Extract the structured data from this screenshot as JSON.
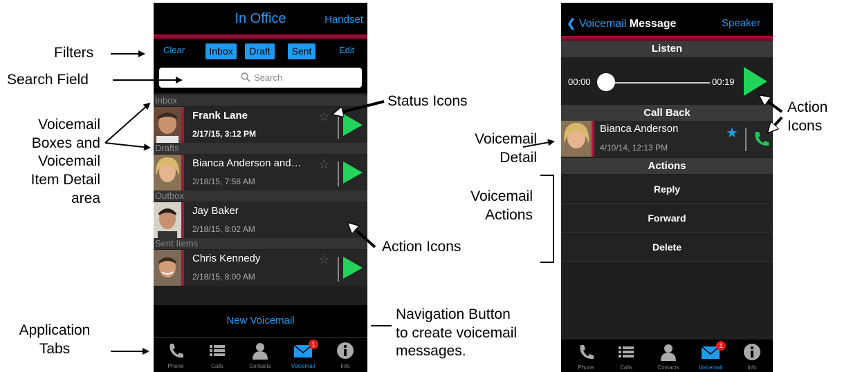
{
  "annotations": {
    "filters": "Filters",
    "search_field": "Search Field",
    "voicemail_boxes": [
      "Voicemail",
      "Boxes and",
      "Voicemail",
      "Item Detail",
      "area"
    ],
    "application_tabs": [
      "Application",
      "Tabs"
    ],
    "status_icons": "Status Icons",
    "action_icons_left": "Action Icons",
    "navigation_button": [
      "Navigation Button",
      "to create voicemail",
      "messages."
    ],
    "action_icons_right": [
      "Action",
      "Icons"
    ],
    "voicemail_detail": [
      "Voicemail",
      "Detail"
    ],
    "voicemail_actions": [
      "Voicemail",
      "Actions"
    ]
  },
  "left_phone": {
    "title": "In Office",
    "handset": "Handset",
    "filters": {
      "clear": "Clear",
      "inbox": "Inbox",
      "draft": "Draft",
      "sent": "Sent",
      "edit": "Edit"
    },
    "search_placeholder": "Search",
    "sections": [
      {
        "label": "Inbox",
        "name": "Frank Lane",
        "date": "2/17/15, 3:12 PM",
        "bold": true
      },
      {
        "label": "Drafts",
        "name": "Bianca Anderson and…",
        "date": "2/18/15, 7:58 AM"
      },
      {
        "label": "Outbox",
        "name": "Jay Baker",
        "date": "2/18/15, 8:02 AM"
      },
      {
        "label": "Sent Items",
        "name": "Chris Kennedy",
        "date": "2/18/15, 8:00 AM"
      }
    ],
    "new_voicemail": "New Voicemail"
  },
  "tabs": {
    "phone": "Phone",
    "calls": "Calls",
    "contacts": "Contacts",
    "voicemail": "Voicemail",
    "info": "Info",
    "badge": "1"
  },
  "right_phone": {
    "back": "Voicemail",
    "title": "Message",
    "speaker": "Speaker",
    "listen": "Listen",
    "time_start": "00:00",
    "time_end": "00:19",
    "call_back": "Call Back",
    "contact_name": "Bianca Anderson",
    "contact_date": "4/10/14, 12:13 PM",
    "actions_header": "Actions",
    "actions": [
      "Reply",
      "Forward",
      "Delete"
    ]
  },
  "colors": {
    "accent": "#1e9bf0",
    "play": "#22d45a",
    "red": "#b0103a",
    "star_active": "#1e9bf0"
  }
}
